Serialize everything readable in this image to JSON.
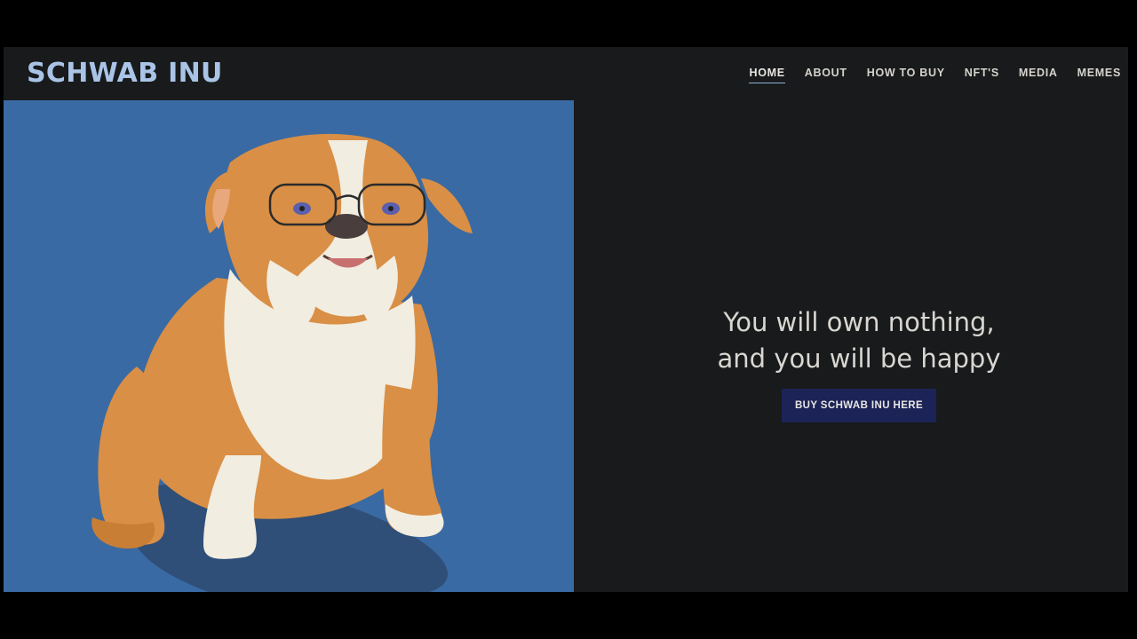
{
  "header": {
    "logo": "SCHWAB INU",
    "nav": [
      "HOME",
      "ABOUT",
      "HOW TO BUY",
      "NFT'S",
      "MEDIA",
      "MEMES"
    ],
    "active_nav": "HOME"
  },
  "hero": {
    "tagline_line1": "You will own nothing,",
    "tagline_line2": "and you will be happy",
    "button_label": "BUY SCHWAB INU HERE"
  },
  "colors": {
    "page_bg": "#181a1b",
    "logo": "#a9c4e6",
    "image_bg": "#3a6aa3",
    "button_bg": "#1c2457",
    "dog_fur_orange": "#d98f45",
    "dog_fur_white": "#f1ede0"
  },
  "images": {
    "hero": "bulldog-with-glasses-illustration"
  }
}
